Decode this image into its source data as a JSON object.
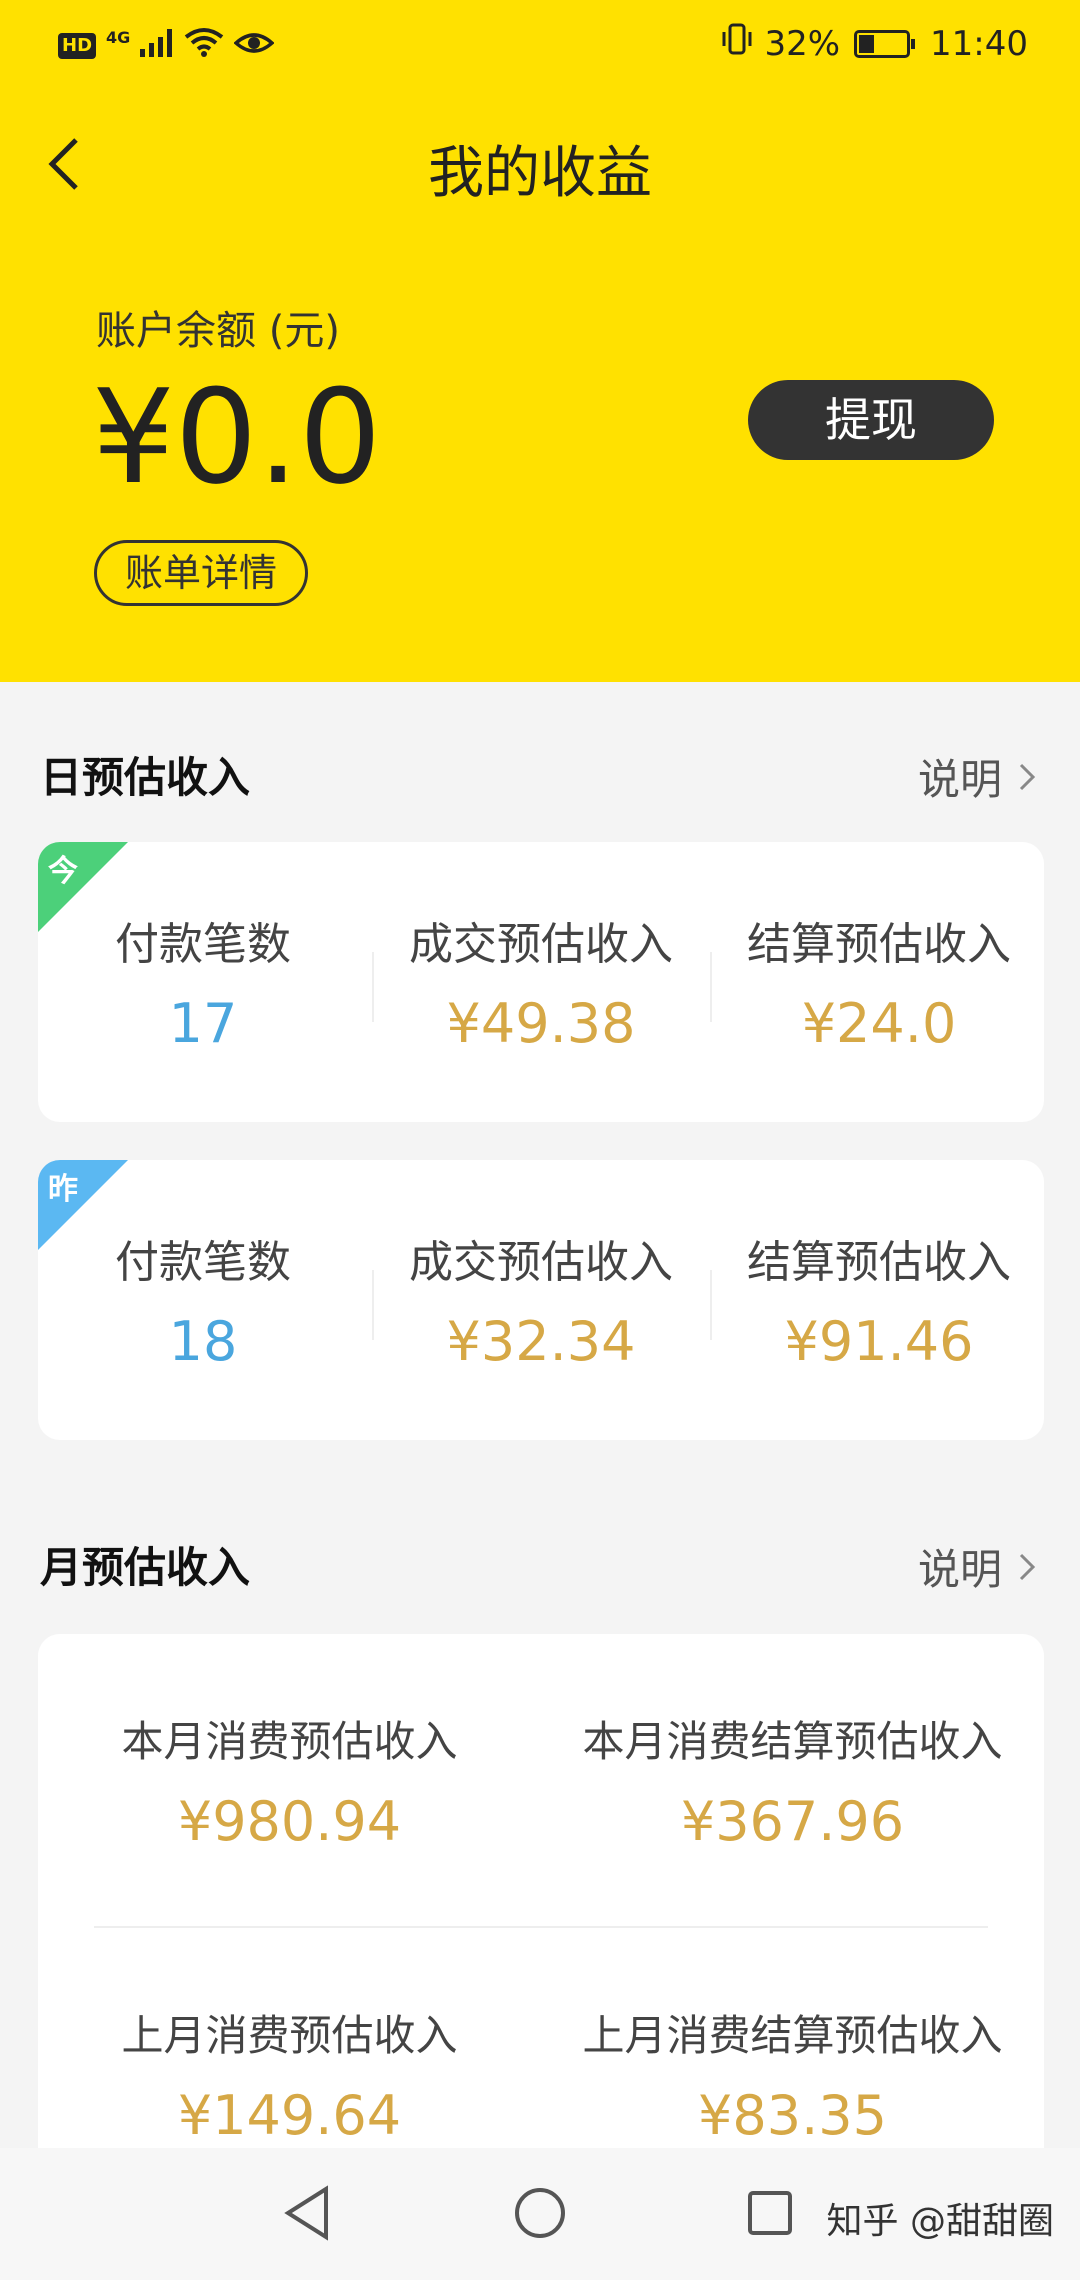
{
  "status_bar": {
    "hd": "HD",
    "network": "4G",
    "battery_percent": "32%",
    "battery_level": 0.32,
    "time": "11:40"
  },
  "nav": {
    "title": "我的收益"
  },
  "account": {
    "balance_label": "账户余额 (元)",
    "balance_value": "¥0.0",
    "withdraw_label": "提现",
    "bill_details_label": "账单详情"
  },
  "daily": {
    "title": "日预估收入",
    "explain_label": "说明",
    "today": {
      "tag": "今",
      "stats": [
        {
          "label": "付款笔数",
          "value": "17"
        },
        {
          "label": "成交预估收入",
          "value": "¥49.38"
        },
        {
          "label": "结算预估收入",
          "value": "¥24.0"
        }
      ]
    },
    "yesterday": {
      "tag": "昨",
      "stats": [
        {
          "label": "付款笔数",
          "value": "18"
        },
        {
          "label": "成交预估收入",
          "value": "¥32.34"
        },
        {
          "label": "结算预估收入",
          "value": "¥91.46"
        }
      ]
    }
  },
  "monthly": {
    "title": "月预估收入",
    "explain_label": "说明",
    "stats": [
      {
        "label": "本月消费预估收入",
        "value": "¥980.94"
      },
      {
        "label": "本月消费结算预估收入",
        "value": "¥367.96"
      },
      {
        "label": "上月消费预估收入",
        "value": "¥149.64"
      },
      {
        "label": "上月消费结算预估收入",
        "value": "¥83.35"
      }
    ]
  },
  "watermark": "知乎 @甜甜圈",
  "colors": {
    "header_bg": "#ffe100",
    "gold": "#d6a846",
    "blue_value": "#4aa6de",
    "today_tag": "#4cd07a",
    "yesterday_tag": "#5bb8f2"
  }
}
